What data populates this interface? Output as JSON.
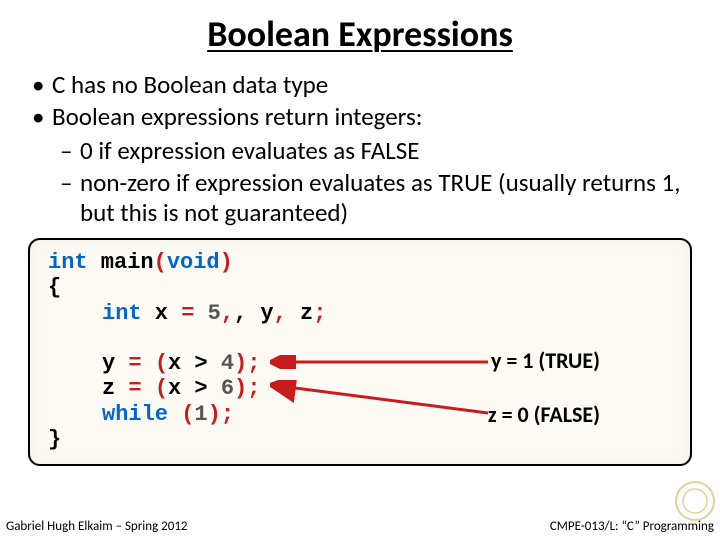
{
  "title": "Boolean Expressions",
  "bullets": [
    "C has no Boolean data type",
    "Boolean expressions return integers:"
  ],
  "sub_bullets": [
    "0 if expression evaluates as FALSE",
    "non-zero if expression evaluates as TRUE (usually returns 1, but this is not guaranteed)"
  ],
  "code": {
    "l1_kw1": "int",
    "l1_main": " main",
    "l1_p_open": "(",
    "l1_kw2": "void",
    "l1_p_close": ")",
    "l2_brace": "{",
    "l3_kw": "int",
    "l3_rest_a": " x ",
    "l3_eq": "=",
    "l3_sp": " ",
    "l3_num": "5",
    "l3_rest_b": ", y",
    "l3_c1": ",",
    "l3_rest_c": " z",
    "l3_semi": ";",
    "l4_a": "y ",
    "l4_eq": "=",
    "l4_b": " ",
    "l4_po": "(",
    "l4_c": "x > ",
    "l4_num": "4",
    "l4_pc": ")",
    "l4_semi": ";",
    "l5_a": "z ",
    "l5_eq": "=",
    "l5_b": " ",
    "l5_po": "(",
    "l5_c": "x > ",
    "l5_num": "6",
    "l5_pc": ")",
    "l5_semi": ";",
    "l6_kw": "while",
    "l6_sp": " ",
    "l6_po": "(",
    "l6_num": "1",
    "l6_pc": ")",
    "l6_semi": ";",
    "l7_brace": "}"
  },
  "annotations": {
    "a1": "y = 1  (TRUE)",
    "a2": "z = 0  (FALSE)"
  },
  "footer": {
    "left": "Gabriel Hugh Elkaim – Spring 2012",
    "right": "CMPE-013/L: “C” Programming"
  }
}
